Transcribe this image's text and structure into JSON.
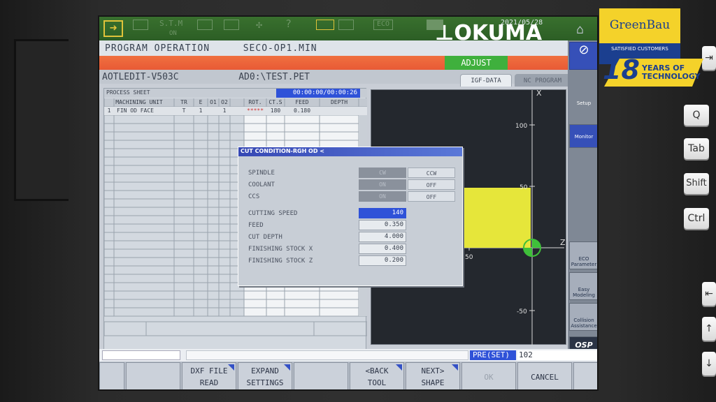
{
  "status_bar": {
    "tabs": [
      "S.T.M",
      "ON"
    ],
    "date": "2021/05/28",
    "mode": "ECO"
  },
  "titlebar": {
    "mode": "PROGRAM OPERATION",
    "program": "SECO-OP1.MIN"
  },
  "alarm_bar": {
    "adjust": "ADJUST"
  },
  "editbar": {
    "editor": "AOTLEDIT-V503C",
    "path": "AD0:\\TEST.PET"
  },
  "tabs": {
    "igf": "IGF-DATA",
    "nc": "NC PROGRAM"
  },
  "process_sheet": {
    "title": "PROCESS SHEET",
    "timer": "00:00:00/00:00:26",
    "columns": [
      "MACHINING UNIT",
      "TR",
      "E",
      "O1",
      "O2",
      "ROT.",
      "CT.S",
      "FEED",
      "DEPTH"
    ],
    "rows": [
      [
        "1",
        "FIN OD FACE",
        "T",
        "1",
        "",
        "1",
        "*****",
        "180",
        "0.180",
        ""
      ]
    ]
  },
  "dialog": {
    "title": "CUT CONDITION-RGH OD <",
    "spindle": {
      "label": "SPINDLE",
      "opt1": "CW",
      "opt2": "CCW"
    },
    "coolant": {
      "label": "COOLANT",
      "opt1": "ON",
      "opt2": "OFF"
    },
    "ccs": {
      "label": "CCS",
      "opt1": "ON",
      "opt2": "OFF"
    },
    "fields": [
      {
        "label": "CUTTING SPEED",
        "value": "140"
      },
      {
        "label": "FEED",
        "value": "0.350"
      },
      {
        "label": "CUT DEPTH",
        "value": "4.000"
      },
      {
        "label": "FINISHING STOCK  X",
        "value": "0.400"
      },
      {
        "label": "FINISHING STOCK  Z",
        "value": "0.200"
      }
    ]
  },
  "graph": {
    "x_axis": "X",
    "z_axis": "Z",
    "tick_100": "100",
    "tick_50": "50",
    "tick_m50": "-50",
    "tick_z50": "50"
  },
  "sidebar": {
    "setup": "Setup",
    "monitor": "Monitor",
    "eco": "ECO Parameter",
    "easy": "Easy Modeling",
    "collision": "Collision Assistance",
    "osp": "OSP"
  },
  "input_line": {
    "mode": "PRE(SET)",
    "value": "102"
  },
  "function_keys": [
    {
      "line1": "",
      "line2": ""
    },
    {
      "line1": "",
      "line2": ""
    },
    {
      "line1": "DXF FILE",
      "line2": "READ"
    },
    {
      "line1": "EXPAND",
      "line2": "SETTINGS"
    },
    {
      "line1": "",
      "line2": ""
    },
    {
      "line1": "<BACK",
      "line2": "TOOL"
    },
    {
      "line1": "NEXT>",
      "line2": "SHAPE"
    },
    {
      "line1": "OK",
      "line2": ""
    },
    {
      "line1": "CANCEL",
      "line2": ""
    },
    {
      "line1": "",
      "line2": ""
    }
  ],
  "keyboard": {
    "k1": "Q",
    "k2": "Tab",
    "k3": "Shift",
    "k4": "Ctrl"
  },
  "logos": {
    "okuma": "OKUMA",
    "greenbau": "GreenBau",
    "greenbau_tagline": "SATISFIED CUSTOMERS",
    "years_num": "18",
    "years_text1": "YEARS OF",
    "years_text2": "TECHNOLOGY"
  },
  "colors": {
    "status_green": "#2c5e25",
    "alarm": "#e85a35",
    "adjust": "#3fb03d",
    "selected": "#2f52d8",
    "workpiece": "#e6e63a"
  }
}
